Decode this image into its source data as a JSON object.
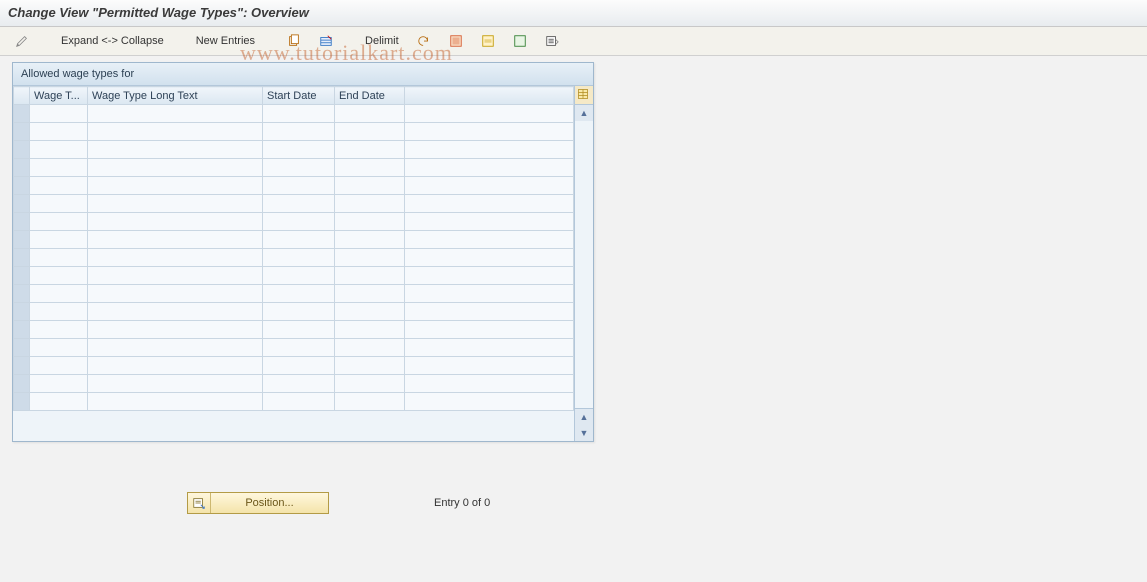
{
  "title": "Change View \"Permitted Wage Types\": Overview",
  "toolbar": {
    "expand_collapse": "Expand <-> Collapse",
    "new_entries": "New Entries",
    "delimit": "Delimit"
  },
  "panel": {
    "heading": "Allowed wage types for"
  },
  "columns": {
    "wage_type_short": "Wage T...",
    "wage_type_long": "Wage Type Long Text",
    "start_date": "Start Date",
    "end_date": "End Date"
  },
  "rows": [
    {
      "sel": "",
      "wt": "",
      "lt": "",
      "sd": "",
      "ed": ""
    },
    {
      "sel": "",
      "wt": "",
      "lt": "",
      "sd": "",
      "ed": ""
    },
    {
      "sel": "",
      "wt": "",
      "lt": "",
      "sd": "",
      "ed": ""
    },
    {
      "sel": "",
      "wt": "",
      "lt": "",
      "sd": "",
      "ed": ""
    },
    {
      "sel": "",
      "wt": "",
      "lt": "",
      "sd": "",
      "ed": ""
    },
    {
      "sel": "",
      "wt": "",
      "lt": "",
      "sd": "",
      "ed": ""
    },
    {
      "sel": "",
      "wt": "",
      "lt": "",
      "sd": "",
      "ed": ""
    },
    {
      "sel": "",
      "wt": "",
      "lt": "",
      "sd": "",
      "ed": ""
    },
    {
      "sel": "",
      "wt": "",
      "lt": "",
      "sd": "",
      "ed": ""
    },
    {
      "sel": "",
      "wt": "",
      "lt": "",
      "sd": "",
      "ed": ""
    },
    {
      "sel": "",
      "wt": "",
      "lt": "",
      "sd": "",
      "ed": ""
    },
    {
      "sel": "",
      "wt": "",
      "lt": "",
      "sd": "",
      "ed": ""
    },
    {
      "sel": "",
      "wt": "",
      "lt": "",
      "sd": "",
      "ed": ""
    },
    {
      "sel": "",
      "wt": "",
      "lt": "",
      "sd": "",
      "ed": ""
    },
    {
      "sel": "",
      "wt": "",
      "lt": "",
      "sd": "",
      "ed": ""
    },
    {
      "sel": "",
      "wt": "",
      "lt": "",
      "sd": "",
      "ed": ""
    },
    {
      "sel": "",
      "wt": "",
      "lt": "",
      "sd": "",
      "ed": ""
    }
  ],
  "position_button": "Position...",
  "entry_counter": "Entry 0 of 0",
  "watermark": "www.tutorialkart.com"
}
